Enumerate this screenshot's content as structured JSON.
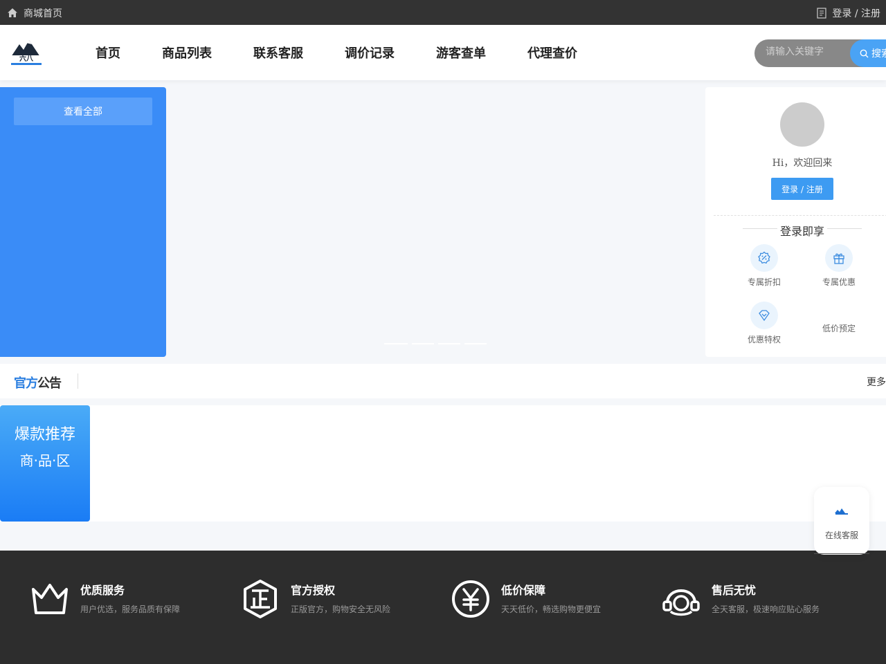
{
  "topbar": {
    "home_label": "商城首页",
    "login_label": "登录 / 注册"
  },
  "nav": {
    "items": [
      "首页",
      "商品列表",
      "联系客服",
      "调价记录",
      "游客查单",
      "代理查价"
    ],
    "search_placeholder": "请输入关键字",
    "search_button": "搜索"
  },
  "category": {
    "view_all": "查看全部"
  },
  "user": {
    "greeting": "Hi，欢迎回来",
    "login_button": "登录 / 注册",
    "perks_title": "登录即享",
    "perks": [
      {
        "label": "专属折扣",
        "icon": "discount-icon"
      },
      {
        "label": "专属优惠",
        "icon": "gift-icon"
      },
      {
        "label": "优惠特权",
        "icon": "diamond-icon"
      },
      {
        "label": "低价预定",
        "icon": ""
      }
    ]
  },
  "notice": {
    "title_part1": "官方",
    "title_part2": "公告",
    "more": "更多"
  },
  "hot": {
    "line1": "爆款推荐",
    "line2": "商·品·区"
  },
  "customer_service": {
    "label": "在线客服"
  },
  "footer": {
    "features": [
      {
        "title": "优质服务",
        "desc": "用户优选，服务品质有保障",
        "icon": "crown-icon"
      },
      {
        "title": "官方授权",
        "desc": "正版官方，购物安全无风险",
        "icon": "authentic-icon"
      },
      {
        "title": "低价保障",
        "desc": "天天低价，畅选购物更便宜",
        "icon": "yen-icon"
      },
      {
        "title": "售后无忧",
        "desc": "全天客服，极速响应贴心服务",
        "icon": "headset-icon"
      }
    ]
  },
  "colors": {
    "primary": "#3a8cf7",
    "topbar": "#333333",
    "footer": "#2d2d2d"
  }
}
